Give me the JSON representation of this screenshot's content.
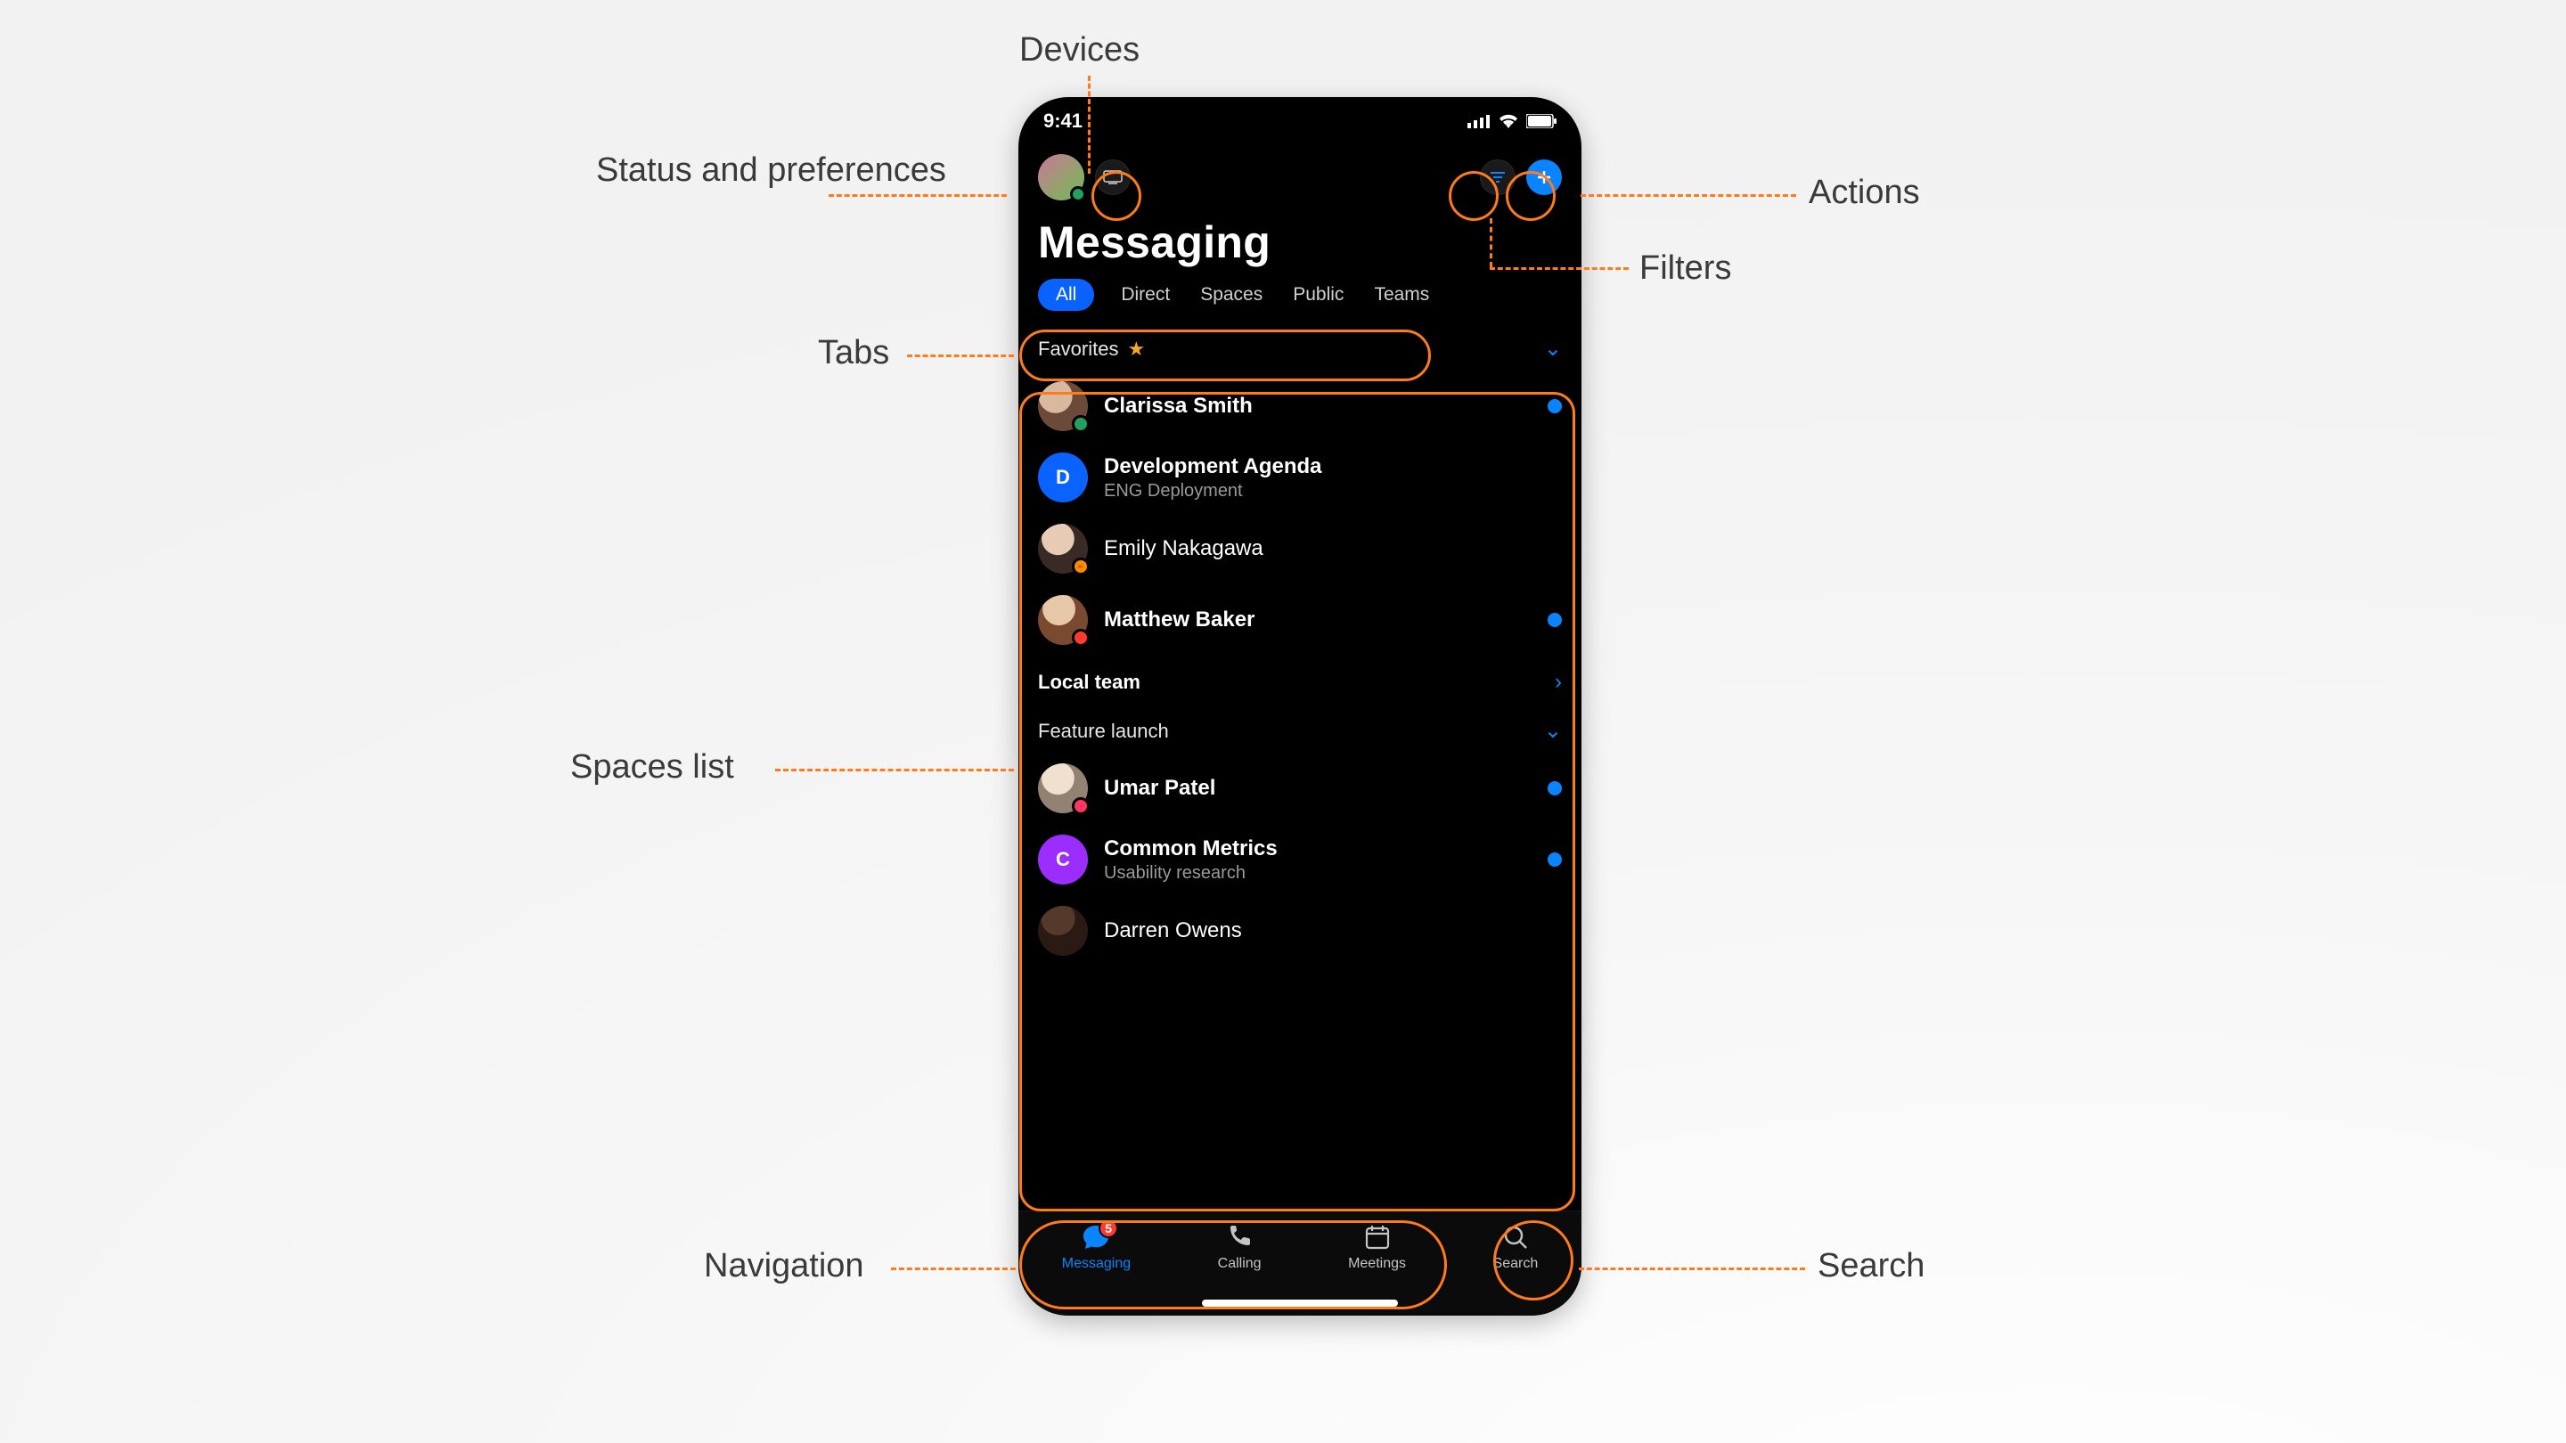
{
  "statusbar": {
    "time": "9:41"
  },
  "header": {
    "title": "Messaging"
  },
  "tabs": [
    {
      "label": "All",
      "active": true
    },
    {
      "label": "Direct",
      "active": false
    },
    {
      "label": "Spaces",
      "active": false
    },
    {
      "label": "Public",
      "active": false
    },
    {
      "label": "Teams",
      "active": false
    }
  ],
  "sections": {
    "favorites": {
      "label": "Favorites"
    },
    "local": {
      "label": "Local team"
    },
    "feature": {
      "label": "Feature launch"
    }
  },
  "rows": {
    "clarissa": {
      "name": "Clarissa Smith"
    },
    "devagenda": {
      "name": "Development Agenda",
      "sub": "ENG Deployment",
      "initial": "D"
    },
    "emily": {
      "name": "Emily Nakagawa"
    },
    "matthew": {
      "name": "Matthew Baker"
    },
    "umar": {
      "name": "Umar Patel"
    },
    "metrics": {
      "name": "Common Metrics",
      "sub": "Usability research",
      "initial": "C"
    },
    "darren": {
      "name": "Darren Owens"
    }
  },
  "nav": {
    "messaging": {
      "label": "Messaging",
      "badge": "5"
    },
    "calling": {
      "label": "Calling"
    },
    "meetings": {
      "label": "Meetings"
    },
    "search": {
      "label": "Search"
    }
  },
  "callouts": {
    "devices": "Devices",
    "statuspref": "Status and preferences",
    "actions": "Actions",
    "filters": "Filters",
    "tabs": "Tabs",
    "spaces": "Spaces list",
    "navigation": "Navigation",
    "search": "Search"
  }
}
